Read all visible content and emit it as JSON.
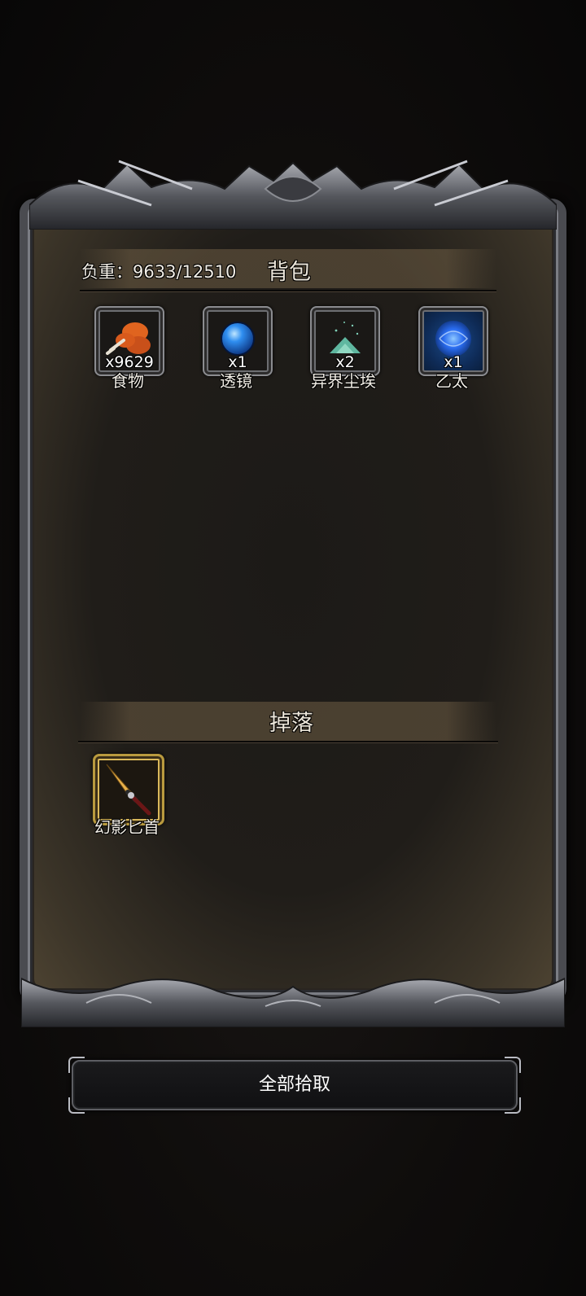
{
  "inventory": {
    "title": "背包",
    "weight_label": "负重：9633/12510",
    "items": [
      {
        "name": "食物",
        "qty": "x9629",
        "icon": "food-icon"
      },
      {
        "name": "透镜",
        "qty": "x1",
        "icon": "lens-orb-icon"
      },
      {
        "name": "异界尘埃",
        "qty": "x2",
        "icon": "dust-pile-icon"
      },
      {
        "name": "乙太",
        "qty": "x1",
        "icon": "ether-orb-icon"
      }
    ]
  },
  "drops": {
    "title": "掉落",
    "items": [
      {
        "name": "幻影匕首",
        "icon": "dagger-icon",
        "rarity_color": "#b99a3e"
      }
    ]
  },
  "actions": {
    "pickup_all_label": "全部拾取"
  },
  "colors": {
    "frame_metal": "#4a4b50",
    "parchment": "#201d19",
    "gold_rarity": "#b99a3e",
    "ether_blue": "#1b4a8a"
  }
}
